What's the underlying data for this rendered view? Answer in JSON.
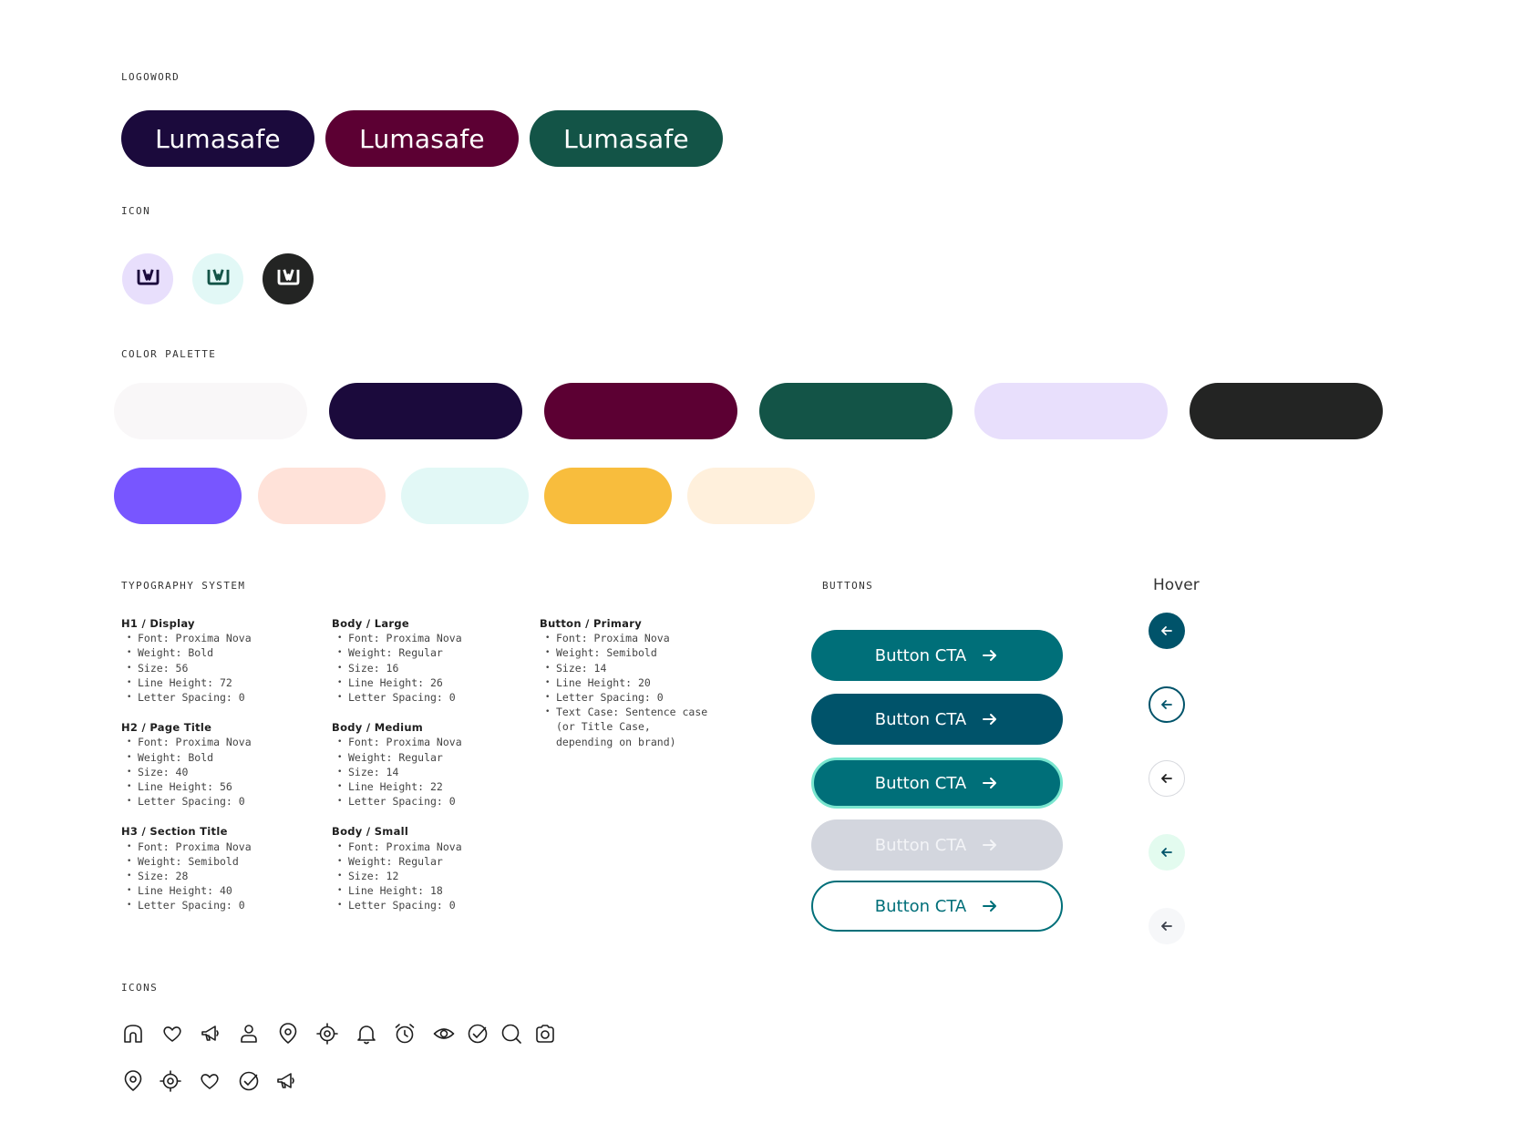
{
  "sections": {
    "logoword": "LOGOWORD",
    "icon": "ICON",
    "palette": "COLOR PALETTE",
    "typography": "TYPOGRAPHY SYSTEM",
    "buttons": "BUTTONS",
    "hover": "Hover",
    "icons": "ICONS"
  },
  "logowords": [
    {
      "text": "Lumasafe",
      "color": "#1b0a3c"
    },
    {
      "text": "Lumasafe",
      "color": "#5c0033"
    },
    {
      "text": "Lumasafe",
      "color": "#135447"
    }
  ],
  "app_icons": [
    {
      "bg": "#e8dffc",
      "fg": "#1b0a3c",
      "icon": "lumasafe-mark-icon"
    },
    {
      "bg": "#e2f8f6",
      "fg": "#135447",
      "icon": "lumasafe-mark-icon"
    },
    {
      "bg": "#232423",
      "fg": "#ffffff",
      "icon": "lumasafe-mark-icon"
    }
  ],
  "palette_row1": [
    "#f9f7f8",
    "#1b0a3c",
    "#5c0033",
    "#135447",
    "#e8dffc",
    "#232423"
  ],
  "palette_row2": [
    "#7856ff",
    "#ffe2d9",
    "#e2f8f6",
    "#f8bd3d",
    "#fff0dc"
  ],
  "typography": {
    "col1": [
      {
        "title": "H1 / Display",
        "items": [
          "Font: Proxima Nova",
          "Weight: Bold",
          "Size: 56",
          "Line Height: 72",
          "Letter Spacing: 0"
        ]
      },
      {
        "title": "H2 / Page Title",
        "items": [
          "Font: Proxima Nova",
          "Weight: Bold",
          "Size: 40",
          "Line Height: 56",
          "Letter Spacing: 0"
        ]
      },
      {
        "title": "H3 / Section Title",
        "items": [
          "Font: Proxima Nova",
          "Weight: Semibold",
          "Size: 28",
          "Line Height: 40",
          "Letter Spacing: 0"
        ]
      }
    ],
    "col2": [
      {
        "title": "Body / Large",
        "items": [
          "Font: Proxima Nova",
          "Weight: Regular",
          "Size: 16",
          "Line Height: 26",
          "Letter Spacing: 0"
        ]
      },
      {
        "title": "Body / Medium",
        "items": [
          "Font: Proxima Nova",
          "Weight: Regular",
          "Size: 14",
          "Line Height: 22",
          "Letter Spacing: 0"
        ]
      },
      {
        "title": "Body / Small",
        "items": [
          "Font: Proxima Nova",
          "Weight: Regular",
          "Size: 12",
          "Line Height: 18",
          "Letter Spacing: 0"
        ]
      }
    ],
    "col3": [
      {
        "title": "Button / Primary",
        "items": [
          "Font: Proxima Nova",
          "Weight: Semibold",
          "Size: 14",
          "Line Height: 20",
          "Letter Spacing: 0",
          "Text Case: Sentence case (or Title Case, depending on brand)"
        ]
      }
    ]
  },
  "buttons": {
    "label": "Button CTA",
    "variants": [
      {
        "state": "default",
        "bg": "#006f79",
        "fg": "#ffffff",
        "border": "none"
      },
      {
        "state": "hover",
        "bg": "#00536a",
        "fg": "#ffffff",
        "border": "none"
      },
      {
        "state": "focus",
        "bg": "#006f79",
        "fg": "#ffffff",
        "border": "3px solid #7ae6cf"
      },
      {
        "state": "disabled",
        "bg": "#d3d6de",
        "fg": "#f3f4f7",
        "border": "none"
      },
      {
        "state": "outline",
        "bg": "#ffffff",
        "fg": "#006f79",
        "border": "2px solid #006f79"
      }
    ]
  },
  "hover_buttons": [
    {
      "bg": "#00536a",
      "fg": "#ffffff",
      "border": "none"
    },
    {
      "bg": "#ffffff",
      "fg": "#00536a",
      "border": "2px solid #00536a"
    },
    {
      "bg": "#ffffff",
      "fg": "#1e1e1e",
      "border": "1px solid #d7d9de"
    },
    {
      "bg": "#e3fbef",
      "fg": "#00536a",
      "border": "none"
    },
    {
      "bg": "#f6f7f9",
      "fg": "#3a3f4b",
      "border": "none"
    }
  ],
  "icons_row1": [
    "home-icon",
    "heart-icon",
    "megaphone-icon",
    "user-icon",
    "location-pin-icon",
    "target-icon",
    "bell-icon",
    "alarm-clock-icon",
    "eye-icon",
    "check-circle-icon",
    "search-icon",
    "camera-icon"
  ],
  "icons_row2": [
    "location-pin-icon",
    "target-icon",
    "heart-icon",
    "check-circle-icon",
    "megaphone-icon"
  ]
}
